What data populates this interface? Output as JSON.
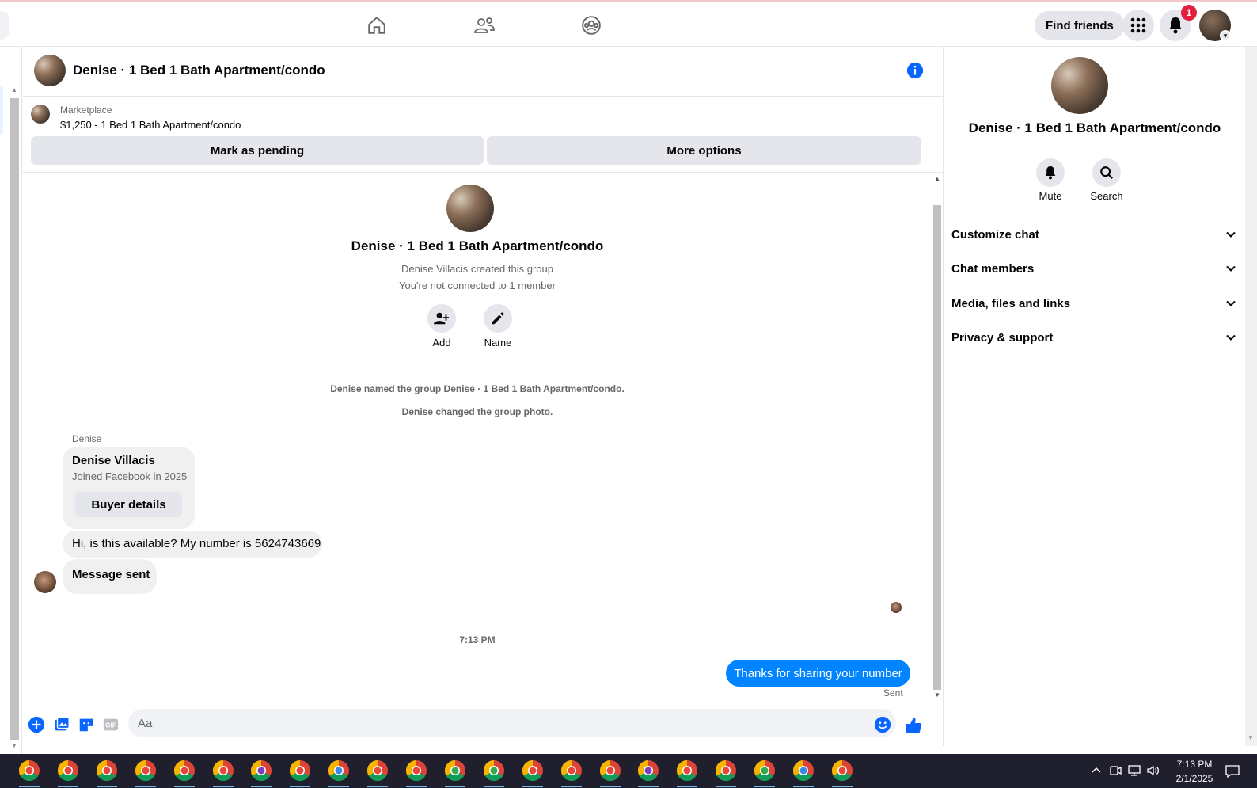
{
  "topbar": {
    "find_friends_label": "Find friends",
    "notification_count": "1"
  },
  "chat": {
    "title": "Denise · 1 Bed 1 Bath Apartment/condo",
    "marketplace_label": "Marketplace",
    "listing": "$1,250 - 1 Bed 1 Bath Apartment/condo",
    "mark_pending_label": "Mark as pending",
    "more_options_label": "More options"
  },
  "intro": {
    "title": "Denise · 1 Bed 1 Bath Apartment/condo",
    "created": "Denise Villacis created this group",
    "connection": "You're not connected to 1 member",
    "add_label": "Add",
    "name_label": "Name",
    "system_named": "Denise named the group Denise · 1 Bed 1 Bath Apartment/condo.",
    "system_photo": "Denise changed the group photo."
  },
  "messages": {
    "sender_name": "Denise",
    "card_name": "Denise Villacis",
    "card_subtitle": "Joined Facebook in 2025",
    "buyer_details_label": "Buyer details",
    "msg1": "Hi, is this available? My number is 5624743669",
    "msg2": "Message sent",
    "timestamp": "7:13 PM",
    "sent_msg": "Thanks for sharing your number",
    "sent_status": "Sent"
  },
  "composer": {
    "placeholder": "Aa"
  },
  "sidebar": {
    "title": "Denise · 1 Bed 1 Bath Apartment/condo",
    "mute_label": "Mute",
    "search_label": "Search",
    "sections": [
      "Customize chat",
      "Chat members",
      "Media, files and links",
      "Privacy & support"
    ]
  },
  "taskbar": {
    "time": "7:13 PM",
    "date": "2/1/2025"
  },
  "colors": {
    "accent": "#0084ff",
    "badge": "#e41e3f"
  }
}
